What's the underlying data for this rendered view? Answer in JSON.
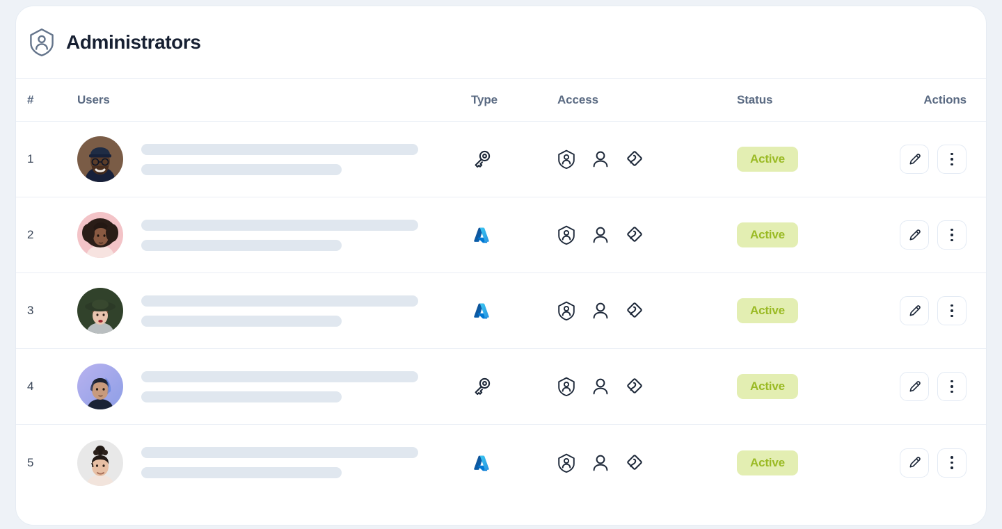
{
  "header": {
    "title": "Administrators",
    "icon": "shield-person-icon"
  },
  "table": {
    "columns": [
      {
        "key": "num",
        "label": "#"
      },
      {
        "key": "users",
        "label": "Users"
      },
      {
        "key": "type",
        "label": "Type"
      },
      {
        "key": "access",
        "label": "Access"
      },
      {
        "key": "status",
        "label": "Status"
      },
      {
        "key": "actions",
        "label": "Actions"
      }
    ],
    "rows": [
      {
        "num": "1",
        "avatar": {
          "name": "avatar-user-1",
          "bg": "#7a5c46",
          "skin": "#5a3c28",
          "hair": "#1b2535",
          "hat": "#1f2c44"
        },
        "type": {
          "icon": "key-icon",
          "label": "Key"
        },
        "access": [
          "shield-person-icon",
          "user-icon",
          "nodes-icon"
        ],
        "status": "Active",
        "actions": [
          "edit-icon",
          "more-vertical-icon"
        ]
      },
      {
        "num": "2",
        "avatar": {
          "name": "avatar-user-2",
          "bg": "#f3c3c7",
          "skin": "#8a5a42",
          "hair": "#2a1d17",
          "hat": ""
        },
        "type": {
          "icon": "azure-icon",
          "label": "Azure"
        },
        "access": [
          "shield-person-icon",
          "user-icon",
          "nodes-icon"
        ],
        "status": "Active",
        "actions": [
          "edit-icon",
          "more-vertical-icon"
        ]
      },
      {
        "num": "3",
        "avatar": {
          "name": "avatar-user-3",
          "bg": "#31422b",
          "skin": "#e8c4ae",
          "hair": "#6b4a2f",
          "hat": "#2c3a27"
        },
        "type": {
          "icon": "azure-icon",
          "label": "Azure"
        },
        "access": [
          "shield-person-icon",
          "user-icon",
          "nodes-icon"
        ],
        "status": "Active",
        "actions": [
          "edit-icon",
          "more-vertical-icon"
        ]
      },
      {
        "num": "4",
        "avatar": {
          "name": "avatar-user-4",
          "bg": "#a7a6e8",
          "skin": "#c79a7c",
          "hair": "#1d2230",
          "hat": ""
        },
        "type": {
          "icon": "key-icon",
          "label": "Key"
        },
        "access": [
          "shield-person-icon",
          "user-icon",
          "nodes-icon"
        ],
        "status": "Active",
        "actions": [
          "edit-icon",
          "more-vertical-icon"
        ]
      },
      {
        "num": "5",
        "avatar": {
          "name": "avatar-user-5",
          "bg": "#e8e8e8",
          "skin": "#e7bfa4",
          "hair": "#221a16",
          "hat": ""
        },
        "type": {
          "icon": "azure-icon",
          "label": "Azure"
        },
        "access": [
          "shield-person-icon",
          "user-icon",
          "nodes-icon"
        ],
        "status": "Active",
        "actions": [
          "edit-icon",
          "more-vertical-icon"
        ]
      }
    ]
  },
  "colors": {
    "card_bg": "#ffffff",
    "page_bg": "#eef2f7",
    "title": "#172032",
    "header_text": "#5a6a82",
    "divider": "#e9eef5",
    "skeleton": "#e0e7ef",
    "badge_bg": "#e3eeb2",
    "badge_text": "#9aba24",
    "icon_dark": "#1c2738",
    "azure_blue": "#0f84d8"
  }
}
